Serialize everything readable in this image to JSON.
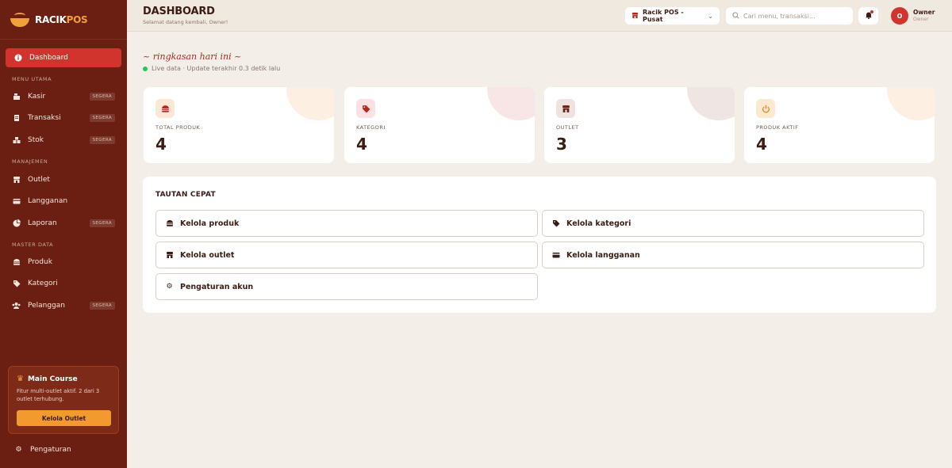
{
  "brand": {
    "name_part1": "RACIK",
    "name_part2": "POS"
  },
  "sidebar": {
    "active": {
      "label": "Dashboard",
      "icon": "info-icon"
    },
    "sections": [
      {
        "title": "MENU UTAMA"
      },
      {
        "title": "MANAJEMEN"
      },
      {
        "title": "MASTER DATA"
      }
    ],
    "items": [
      {
        "label": "Kasir",
        "badge": "SEGERA",
        "icon": "cash-register-icon"
      },
      {
        "label": "Transaksi",
        "badge": "SEGERA",
        "icon": "receipt-icon"
      },
      {
        "label": "Stok",
        "badge": "SEGERA",
        "icon": "boxes-icon"
      },
      {
        "label": "Outlet",
        "badge": "",
        "icon": "store-icon"
      },
      {
        "label": "Langganan",
        "badge": "",
        "icon": "card-icon"
      },
      {
        "label": "Laporan",
        "badge": "SEGERA",
        "icon": "pie-chart-icon"
      },
      {
        "label": "Produk",
        "badge": "",
        "icon": "burger-icon"
      },
      {
        "label": "Kategori",
        "badge": "",
        "icon": "tags-icon"
      },
      {
        "label": "Pelanggan",
        "badge": "SEGERA",
        "icon": "users-icon"
      }
    ],
    "promo": {
      "title": "Main Course",
      "text": "Fitur multi-outlet aktif. 2 dari 3 outlet terhubung.",
      "button": "Kelola Outlet"
    },
    "settings_label": "Pengaturan"
  },
  "header": {
    "title": "DASHBOARD",
    "subtitle": "Selamat datang kembali, Owner!",
    "outlet_selector": "Racik POS - Pusat",
    "search_placeholder": "Cari menu, transaksi...",
    "avatar_initial": "O",
    "user_name": "Owner",
    "user_role": "Owner"
  },
  "main": {
    "summary_title": "~ ringkasan hari ini ~",
    "live_text": "Live data · Update terakhir 0.3 detik lalu",
    "stats": [
      {
        "label": "TOTAL PRODUK",
        "value": "4",
        "icon": "burger-icon",
        "icon_bg": "#fde8d8",
        "icon_color": "#b3281f",
        "blob": "#fdf0e2"
      },
      {
        "label": "KATEGORI",
        "value": "4",
        "icon": "tags-icon",
        "icon_bg": "#fbe1e4",
        "icon_color": "#b3281f",
        "blob": "#f8e6e6"
      },
      {
        "label": "OUTLET",
        "value": "3",
        "icon": "store-icon",
        "icon_bg": "#efe3df",
        "icon_color": "#6b1f12",
        "blob": "#efe5e2"
      },
      {
        "label": "PRODUK AKTIF",
        "value": "4",
        "icon": "power-icon",
        "icon_bg": "#fde9cf",
        "icon_color": "#e08a1e",
        "blob": "#fdf0e2"
      }
    ],
    "quick_links": {
      "title": "TAUTAN CEPAT",
      "items": [
        {
          "label": "Kelola produk",
          "icon": "burger-icon"
        },
        {
          "label": "Kelola kategori",
          "icon": "tags-icon"
        },
        {
          "label": "Kelola outlet",
          "icon": "store-icon"
        },
        {
          "label": "Kelola langganan",
          "icon": "card-icon"
        },
        {
          "label": "Pengaturan akun",
          "icon": "gear-icon"
        }
      ]
    }
  }
}
